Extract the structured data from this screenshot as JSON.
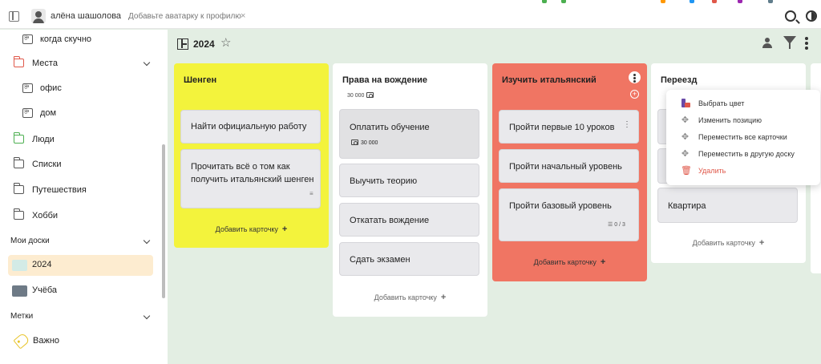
{
  "header": {
    "username": "алёна шашолова",
    "hint": "Добавьте аватарку к профилю",
    "hint_close": "×"
  },
  "sidebar": {
    "items": [
      {
        "label": "когда скучно"
      },
      {
        "label": "Места"
      },
      {
        "label": "офис"
      },
      {
        "label": "дом"
      },
      {
        "label": "Люди"
      },
      {
        "label": "Списки"
      },
      {
        "label": "Путешествия"
      },
      {
        "label": "Хобби"
      }
    ],
    "boards_section": "Мои доски",
    "boards": [
      {
        "label": "2024",
        "color": "#d3ebe6"
      },
      {
        "label": "Учёба",
        "color": "#6e7a86"
      }
    ],
    "tags_section": "Метки",
    "tags": [
      {
        "label": "Важно",
        "color": "#e8c42a"
      }
    ]
  },
  "board": {
    "title": "2024"
  },
  "columns": [
    {
      "title": "Шенген",
      "color": "#f3f33c",
      "cards": [
        {
          "text": "Найти официальную работу"
        },
        {
          "text": "Прочитать всё о том как получить итальянский шенген"
        }
      ],
      "add_label": "Добавить карточку"
    },
    {
      "title": "Права на вождение",
      "subtitle": "30 000",
      "color": "#ffffff",
      "cards": [
        {
          "text": "Оплатить обучение",
          "amount": "30 000"
        },
        {
          "text": "Выучить теорию"
        },
        {
          "text": "Откатать вождение"
        },
        {
          "text": "Сдать экзамен"
        }
      ],
      "add_label": "Добавить карточку"
    },
    {
      "title": "Изучить итальянский",
      "color": "#f07563",
      "cards": [
        {
          "text": "Пройти первые 10 уроков"
        },
        {
          "text": "Пройти начальный уровень"
        },
        {
          "text": "Пройти базовый уровень",
          "checklist": "0 / 3"
        }
      ],
      "add_label": "Добавить карточку"
    },
    {
      "title": "Переезд",
      "color": "#ffffff",
      "cards": [
        {
          "text": "Квартира"
        }
      ],
      "add_label": "Добавить карточку"
    }
  ],
  "context_menu": {
    "items": [
      {
        "label": "Выбрать цвет",
        "icon": "palette-icon"
      },
      {
        "label": "Изменить позицию",
        "icon": "move-icon"
      },
      {
        "label": "Переместить все карточки",
        "icon": "move-icon"
      },
      {
        "label": "Переместить в другую доску",
        "icon": "move-icon"
      },
      {
        "label": "Удалить",
        "icon": "trash-icon",
        "color": "#e0584a"
      }
    ]
  }
}
